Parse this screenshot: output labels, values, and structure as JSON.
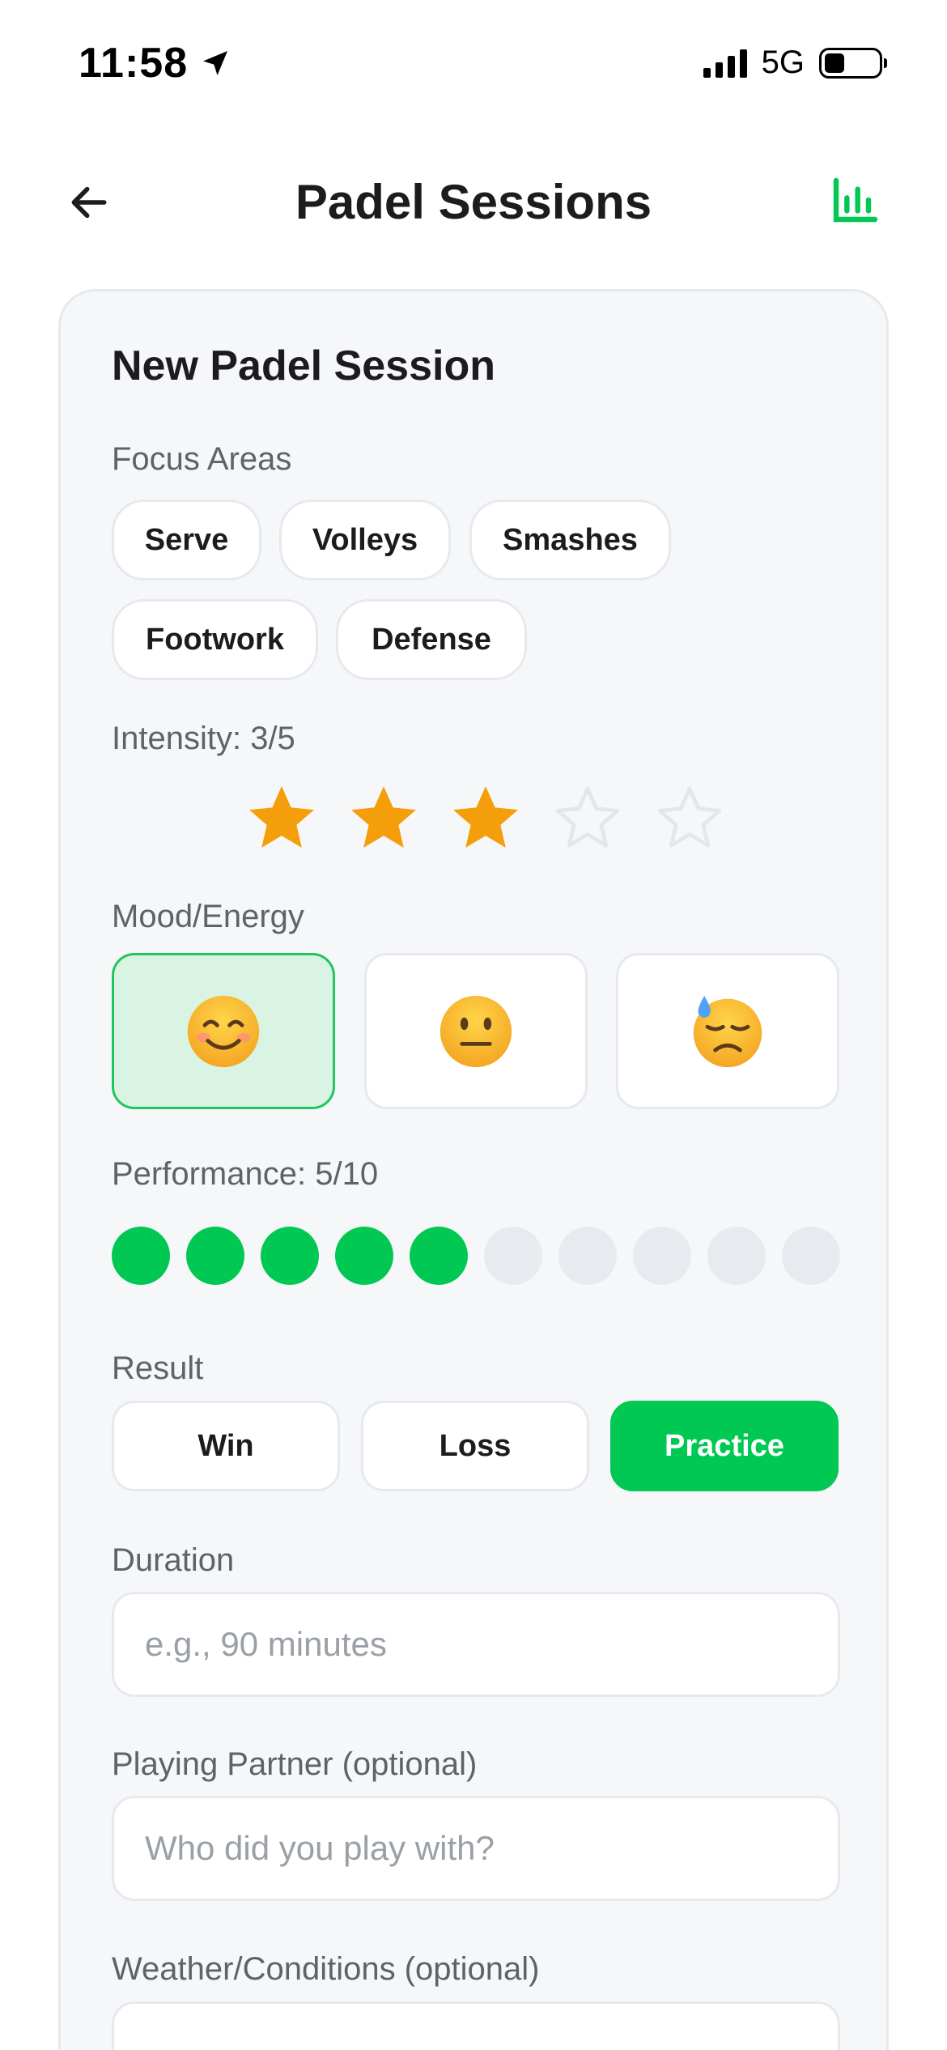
{
  "status_bar": {
    "time": "11:58",
    "network": "5G"
  },
  "header": {
    "title": "Padel Sessions"
  },
  "card": {
    "title": "New Padel Session",
    "focus_areas": {
      "label": "Focus Areas",
      "chips": [
        "Serve",
        "Volleys",
        "Smashes",
        "Footwork",
        "Defense"
      ]
    },
    "intensity": {
      "label": "Intensity: 3/5",
      "value": 3,
      "max": 5
    },
    "mood": {
      "label": "Mood/Energy",
      "options": [
        {
          "name": "smiling-face",
          "selected": true
        },
        {
          "name": "neutral-face",
          "selected": false
        },
        {
          "name": "downcast-face-with-sweat",
          "selected": false
        }
      ]
    },
    "performance": {
      "label": "Performance: 5/10",
      "value": 5,
      "max": 10
    },
    "result": {
      "label": "Result",
      "options": [
        "Win",
        "Loss",
        "Practice"
      ],
      "selected": "Practice"
    },
    "duration": {
      "label": "Duration",
      "placeholder": "e.g., 90 minutes",
      "value": ""
    },
    "partner": {
      "label": "Playing Partner (optional)",
      "placeholder": "Who did you play with?",
      "value": ""
    },
    "weather": {
      "label": "Weather/Conditions (optional)"
    }
  },
  "colors": {
    "accent": "#00c853",
    "star": "#f59e0b",
    "star_empty": "#e6e9ee",
    "card_bg": "#f6f7f9"
  }
}
